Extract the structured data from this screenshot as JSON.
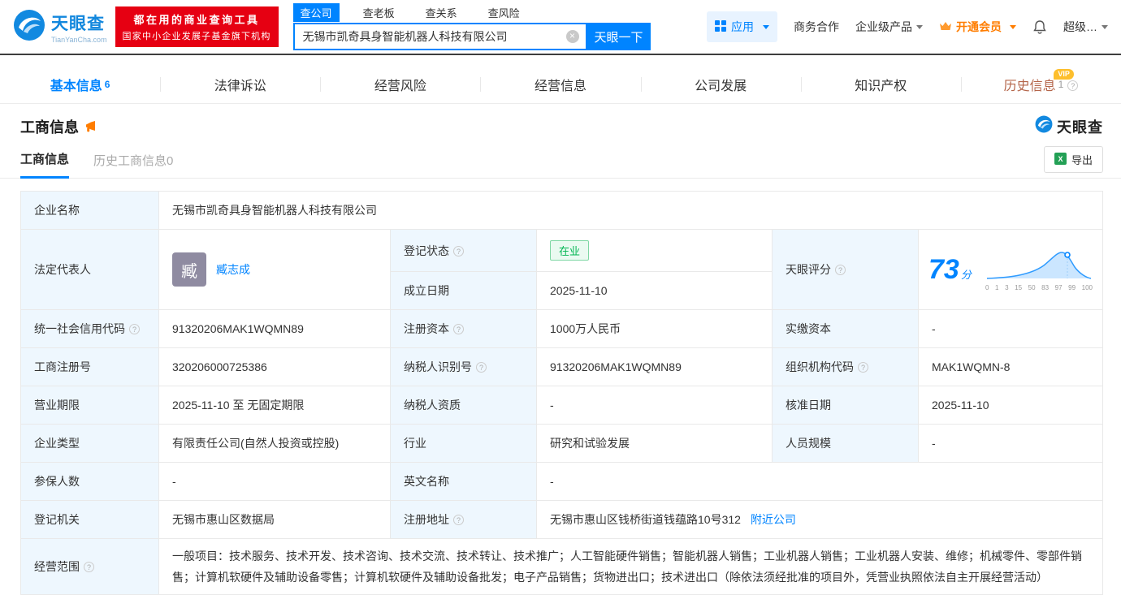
{
  "colors": {
    "brand_blue": "#0084ff",
    "badge_red": "#e60012",
    "vip_orange": "#ff7d00",
    "status_green": "#00b551",
    "history_tab_brown": "#b4654a"
  },
  "header": {
    "logo_title": "天眼查",
    "logo_subtitle": "TianYanCha.com",
    "promo_line1": "都在用的商业查询工具",
    "promo_line2": "国家中小企业发展子基金旗下机构",
    "search_tabs": [
      {
        "label": "查公司",
        "active": true
      },
      {
        "label": "查老板",
        "active": false
      },
      {
        "label": "查关系",
        "active": false
      },
      {
        "label": "查风险",
        "active": false
      }
    ],
    "search_value": "无锡市凯奇具身智能机器人科技有限公司",
    "search_button": "天眼一下",
    "app_label": "应用",
    "links": [
      "商务合作",
      "企业级产品"
    ],
    "vip_label": "开通会员",
    "more_label": "超级…"
  },
  "nav_tabs": [
    {
      "label": "基本信息",
      "count": "6",
      "active": true
    },
    {
      "label": "法律诉讼",
      "count": ""
    },
    {
      "label": "经营风险",
      "count": ""
    },
    {
      "label": "经营信息",
      "count": ""
    },
    {
      "label": "公司发展",
      "count": ""
    },
    {
      "label": "知识产权",
      "count": ""
    },
    {
      "label": "历史信息",
      "count": "1",
      "vip": "VIP"
    }
  ],
  "section": {
    "title": "工商信息",
    "brand": "天眼查",
    "subtab_active": "工商信息",
    "subtab_inactive": "历史工商信息0",
    "export_label": "导出"
  },
  "score_chart": {
    "score": "73",
    "unit": "分",
    "ticks": [
      "0",
      "1",
      "3",
      "15",
      "50",
      "83",
      "97",
      "99",
      "100"
    ]
  },
  "info": {
    "company_name": {
      "label": "企业名称",
      "value": "无锡市凯奇具身智能机器人科技有限公司"
    },
    "legal_rep": {
      "label": "法定代表人",
      "name": "臧志成",
      "avatar": "臧"
    },
    "reg_status": {
      "label": "登记状态",
      "value": "在业"
    },
    "establish_date": {
      "label": "成立日期",
      "value": "2025-11-10"
    },
    "tyc_score": {
      "label": "天眼评分"
    },
    "credit_code": {
      "label": "统一社会信用代码",
      "value": "91320206MAK1WQMN89"
    },
    "reg_capital": {
      "label": "注册资本",
      "value": "1000万人民币"
    },
    "paid_capital": {
      "label": "实缴资本",
      "value": "-"
    },
    "reg_number": {
      "label": "工商注册号",
      "value": "320206000725386"
    },
    "taxpayer_id": {
      "label": "纳税人识别号",
      "value": "91320206MAK1WQMN89"
    },
    "org_code": {
      "label": "组织机构代码",
      "value": "MAK1WQMN-8"
    },
    "business_term": {
      "label": "营业期限",
      "value": "2025-11-10 至 无固定期限"
    },
    "taxpayer_quality": {
      "label": "纳税人资质",
      "value": "-"
    },
    "approval_date": {
      "label": "核准日期",
      "value": "2025-11-10"
    },
    "company_type": {
      "label": "企业类型",
      "value": "有限责任公司(自然人投资或控股)"
    },
    "industry": {
      "label": "行业",
      "value": "研究和试验发展"
    },
    "staff_size": {
      "label": "人员规模",
      "value": "-"
    },
    "insured_count": {
      "label": "参保人数",
      "value": "-"
    },
    "english_name": {
      "label": "英文名称",
      "value": "-"
    },
    "reg_authority": {
      "label": "登记机关",
      "value": "无锡市惠山区数据局"
    },
    "reg_address": {
      "label": "注册地址",
      "value": "无锡市惠山区钱桥街道钱蕴路10号312",
      "link": "附近公司"
    },
    "business_scope": {
      "label": "经营范围",
      "value": "一般项目：技术服务、技术开发、技术咨询、技术交流、技术转让、技术推广；人工智能硬件销售；智能机器人销售；工业机器人销售；工业机器人安装、维修；机械零件、零部件销售；计算机软硬件及辅助设备零售；计算机软硬件及辅助设备批发；电子产品销售；货物进出口；技术进出口（除依法须经批准的项目外，凭营业执照依法自主开展经营活动）"
    }
  }
}
